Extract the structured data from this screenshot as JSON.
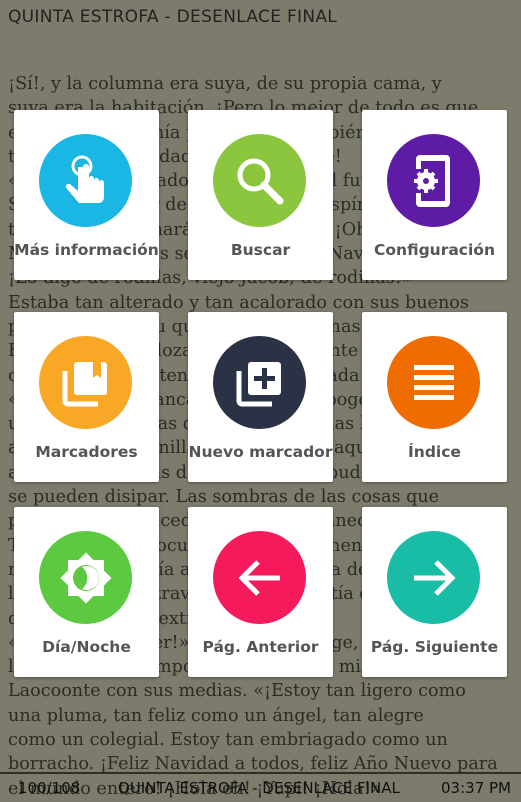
{
  "header": {
    "chapter_title": "QUINTA ESTROFA - DESENLACE FINAL"
  },
  "book_text": "¡Sí!, y la columna era suya, de su propia cama, y\nsuya era la habitación. ¡Pero lo mejor de todo es que\nel tiempo que tenía por delante también era suyo, para\ntener la oportunidad de enmendarse!\n«Viviré en el pasado, el presente y el futuro», repitió\nScrooge al saltar de la cama. «Los espíritus de los\ntres tiempos lucharán dentro de mí. ¡Oh Jacob\nMarley! ¡Benditos sean el cielo y la Navidad por esto!\n¡Lo digo de rodillas, viejo Jacob; de rodillas!»\nEstaba tan alterado y tan acalorado con sus buenos\npropósitos que su quebrada voz apenas le salía.\nHabía estado sollozando violentamente en su lucha\ncon el Espíritu y tenía la cara inundada de lágrimas.\n«¡No las han arrancado!», gritó Scrooge abrazando\nuna de las cortinas de la cama; «no las han\narrancado, con anillas y todo. Están aquí. Yo estoy\naquí. Las sombras de las cosas que pudieron ser\nse pueden disipar. Las sombras de las cosas que\npodrían haber sucedido. Sí, se desvanecerán, lo sé!»\nTenía las manos ocupadas continuamente en sus\nropas: se las ponía al revés, las ponía del derecho,\nlas tiraba, las extraviaba, las convertía en cómplices\nde toda clase de extravagancias.\n«¡No sé qué hacer!», exclamó Scrooge, riendo y\nllorando a un tiempo, haciendo de sí mismo un perfecto\nLaocoonte con sus medias. «¡Estoy tan ligero como\nuna pluma, tan feliz como un ángel, tan alegre\ncomo un colegial. Estoy tan embriagado como un\nborracho. ¡Feliz Navidad a todos, feliz Año Nuevo para\nel mundo entero! ¡Hola eh! ¡Yupi! ¡Hola!»",
  "menu": {
    "more_info": "Más información",
    "search": "Buscar",
    "settings": "Configuración",
    "bookmarks": "Marcadores",
    "new_bookmark": "Nuevo marcador",
    "index": "Índice",
    "day_night": "Día/Noche",
    "prev_page": "Pág. Anterior",
    "next_page": "Pág. Siguiente"
  },
  "icons": {
    "more_info": "touch-icon",
    "search": "search-icon",
    "settings": "phone-settings-icon",
    "bookmarks": "bookmarks-icon",
    "new_bookmark": "add-bookmark-icon",
    "index": "list-icon",
    "day_night": "day-night-icon",
    "prev_page": "arrow-left-icon",
    "next_page": "arrow-right-icon"
  },
  "colors": {
    "more_info": "#1ab7e4",
    "search": "#8cc63e",
    "settings": "#5e1ca6",
    "bookmarks": "#f9a825",
    "new_bookmark": "#2b3245",
    "index": "#ef6c00",
    "day_night": "#5cc940",
    "prev_page": "#f41a5b",
    "next_page": "#19bda6"
  },
  "footer": {
    "page_counter": "100/108",
    "chapter_title": "QUINTA ESTROFA - DESENLACE FINAL",
    "clock": "03:37 PM"
  }
}
